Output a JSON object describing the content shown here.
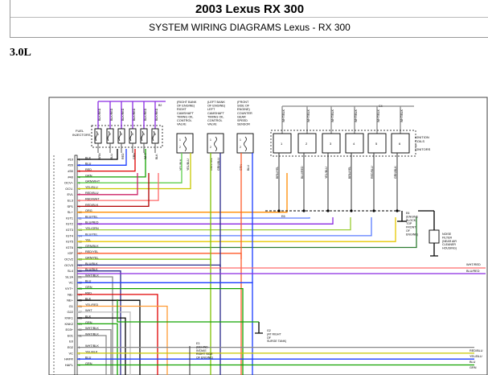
{
  "header": {
    "title": "2003 Lexus RX 300",
    "subtitle": "SYSTEM WIRING DIAGRAMS Lexus - RX 300"
  },
  "section": {
    "engine": "3.0L"
  },
  "diagram": {
    "top_left_wire_labels": [
      "BLK/RED",
      "BLK/RED",
      "BLK/RED",
      "BLK/RED",
      "BLK/RED",
      "BLK/RED"
    ],
    "injector_label": [
      "FUEL",
      "INJECTORS"
    ],
    "injector_pins": [
      "1",
      "2",
      "3",
      "4",
      "5",
      "6"
    ],
    "injector_wire_labels": [
      "BRN",
      "BLU",
      "RED",
      "GRN",
      "WHT",
      "BLK"
    ],
    "vvt_left": {
      "lines": [
        "(RIGHT BANK",
        "OF ENGINE)",
        "RIGHT",
        "CAMSHAFT",
        "TIMING OIL",
        "CONTROL",
        "VALVE"
      ],
      "pin_labels": [
        "1",
        "2"
      ],
      "wire_labels": [
        "YEL/BLK",
        "YEL/BLU"
      ]
    },
    "vvt_mid": {
      "lines": [
        "(LEFT BANK",
        "OF ENGINE)",
        "LEFT",
        "CAMSHAFT",
        "TIMING OIL",
        "CONTROL",
        "VALVE"
      ],
      "pin_labels": [
        "1",
        "2"
      ],
      "wire_labels": [
        "GRN/YEL",
        "GRN/BLU"
      ]
    },
    "vss": {
      "lines": [
        "(FRONT",
        "SIDE OF",
        "ENGINE)",
        "COUNTER",
        "GEAR",
        "SPEED",
        "SENSOR"
      ],
      "pin_labels": [
        "1",
        "2"
      ],
      "wire_labels": [
        "GRN",
        "BLU"
      ]
    },
    "ignition_top_labels": [
      "WHT/BLK",
      "WHT/BLK",
      "WHT/BLK",
      "WHT/BLK",
      "WHT/BLK",
      "WHT/BLK"
    ],
    "ignition_label": [
      "IGNITION",
      "COILS",
      "&",
      "IGNITORS"
    ],
    "ignition_numbers": [
      "1",
      "2",
      "3",
      "4",
      "5",
      "6"
    ],
    "ignition_bottom_labels": [
      "BRN/YEL",
      "BLU/RED",
      "YEL/BLU",
      "BRN/YEL",
      "RED/BLU",
      "GRN/BLK"
    ],
    "ground_labels": [
      "E6",
      "E4",
      "E8"
    ],
    "ground_note": [
      "E6",
      "(ENGINE",
      "BLOCK,",
      "TOP",
      "FRONT",
      "OF",
      "ENGINE)"
    ],
    "noise_filter": [
      "NOISE",
      "FILTER",
      "(NEAR AIR",
      "CLEANER",
      "HOUSING)"
    ],
    "right_wire_labels": [
      "WHT/RED",
      "BLU/RED"
    ],
    "ecm_rows": [
      {
        "conn": "",
        "pin": "1",
        "term": "#10",
        "wire": "BLK"
      },
      {
        "conn": "",
        "pin": "2",
        "term": "#20",
        "wire": "BLU"
      },
      {
        "conn": "",
        "pin": "3",
        "term": "#30",
        "wire": "RED"
      },
      {
        "conn": "",
        "pin": "4",
        "term": "#40",
        "wire": "GRN"
      },
      {
        "conn": "",
        "pin": "5",
        "term": "OCV+",
        "wire": "GRN/WHT"
      },
      {
        "conn": "",
        "pin": "6",
        "term": "OCV-",
        "wire": "YEL/BLU"
      },
      {
        "conn": "",
        "pin": "7",
        "term": "EVL",
        "wire": "RED/BLU"
      },
      {
        "conn": "",
        "pin": "8",
        "term": "EL3",
        "wire": "RED/WHT"
      },
      {
        "conn": "",
        "pin": "9",
        "term": "SP1",
        "wire": "RED/BLK"
      },
      {
        "conn": "",
        "pin": "10",
        "term": "SL+",
        "wire": "ORG"
      },
      {
        "conn": "",
        "pin": "11",
        "term": "IGT1",
        "wire": "BLU/YEL"
      },
      {
        "conn": "",
        "pin": "12",
        "term": "IGT2",
        "wire": "BLU/RED"
      },
      {
        "conn": "",
        "pin": "13",
        "term": "IGT3",
        "wire": "YEL/GRN"
      },
      {
        "conn": "",
        "pin": "14",
        "term": "IGT4",
        "wire": "BLU/YEL"
      },
      {
        "conn": "",
        "pin": "15",
        "term": "IGT5",
        "wire": "YEL"
      },
      {
        "conn": "",
        "pin": "16",
        "term": "IGT6",
        "wire": "GRN/BLK"
      },
      {
        "conn": "",
        "pin": "17",
        "term": "IGF",
        "wire": "RED/YEL"
      },
      {
        "conn": "",
        "pin": "18",
        "term": "OCV2",
        "wire": "GRN/YEL"
      },
      {
        "conn": "",
        "pin": "19",
        "term": "OCV3",
        "wire": "BLU/BLK"
      },
      {
        "conn": "",
        "pin": "20",
        "term": "SL4",
        "wire": "BLU/BLK"
      },
      {
        "conn": "",
        "pin": "21",
        "term": "SL1A",
        "wire": "WHT/BLK"
      },
      {
        "conn": "",
        "pin": "22",
        "term": "VC",
        "wire": "BLU"
      },
      {
        "conn": "",
        "pin": "23",
        "term": "VVT+",
        "wire": "GRN"
      },
      {
        "conn": "",
        "pin": "24",
        "term": "NE-",
        "wire": "RED"
      },
      {
        "conn": "",
        "pin": "25",
        "term": "NE+",
        "wire": "BLK"
      },
      {
        "conn": "",
        "pin": "26",
        "term": "G1",
        "wire": "YEL/RED"
      },
      {
        "conn": "",
        "pin": "27",
        "term": "G22",
        "wire": "WHT"
      },
      {
        "conn": "",
        "pin": "28",
        "term": "KNK1",
        "wire": "BLK"
      },
      {
        "conn": "",
        "pin": "29",
        "term": "KNK2",
        "wire": "GRN"
      },
      {
        "conn": "",
        "pin": "30",
        "term": "E03+",
        "wire": "WHT/BLK"
      },
      {
        "conn": "",
        "pin": "31",
        "term": "E01",
        "wire": "WHT/BLK"
      },
      {
        "conn": "",
        "pin": "",
        "term": "E0",
        "wire": ""
      },
      {
        "conn": "",
        "pin": "1",
        "term": "E02",
        "wire": "WHT/BLK"
      },
      {
        "conn": "",
        "pin": "2",
        "term": "VC",
        "wire": "YEL/BLK"
      },
      {
        "conn": "",
        "pin": "3",
        "term": "HAFR",
        "wire": "BLU"
      },
      {
        "conn": "",
        "pin": "4",
        "term": "HAFL",
        "wire": "GRN"
      }
    ],
    "ecm_left_codes": [
      "E0",
      "E1",
      "E2"
    ],
    "sensor_note": [
      "(NEAR",
      "SUB-",
      "TRANS",
      "SENSOR)"
    ],
    "g_note": [
      "G2",
      "(AT RIGHT",
      "OF",
      "SURGE TANK)"
    ],
    "bottom_right_labels": [
      "RED/BLU",
      "YEL/BLU",
      "BLU",
      "GRN"
    ],
    "e_bottom_note": [
      "E3",
      "(BEHIND",
      "INTAKE",
      "RIGHT SIDE",
      "OF ENGINE)"
    ]
  }
}
